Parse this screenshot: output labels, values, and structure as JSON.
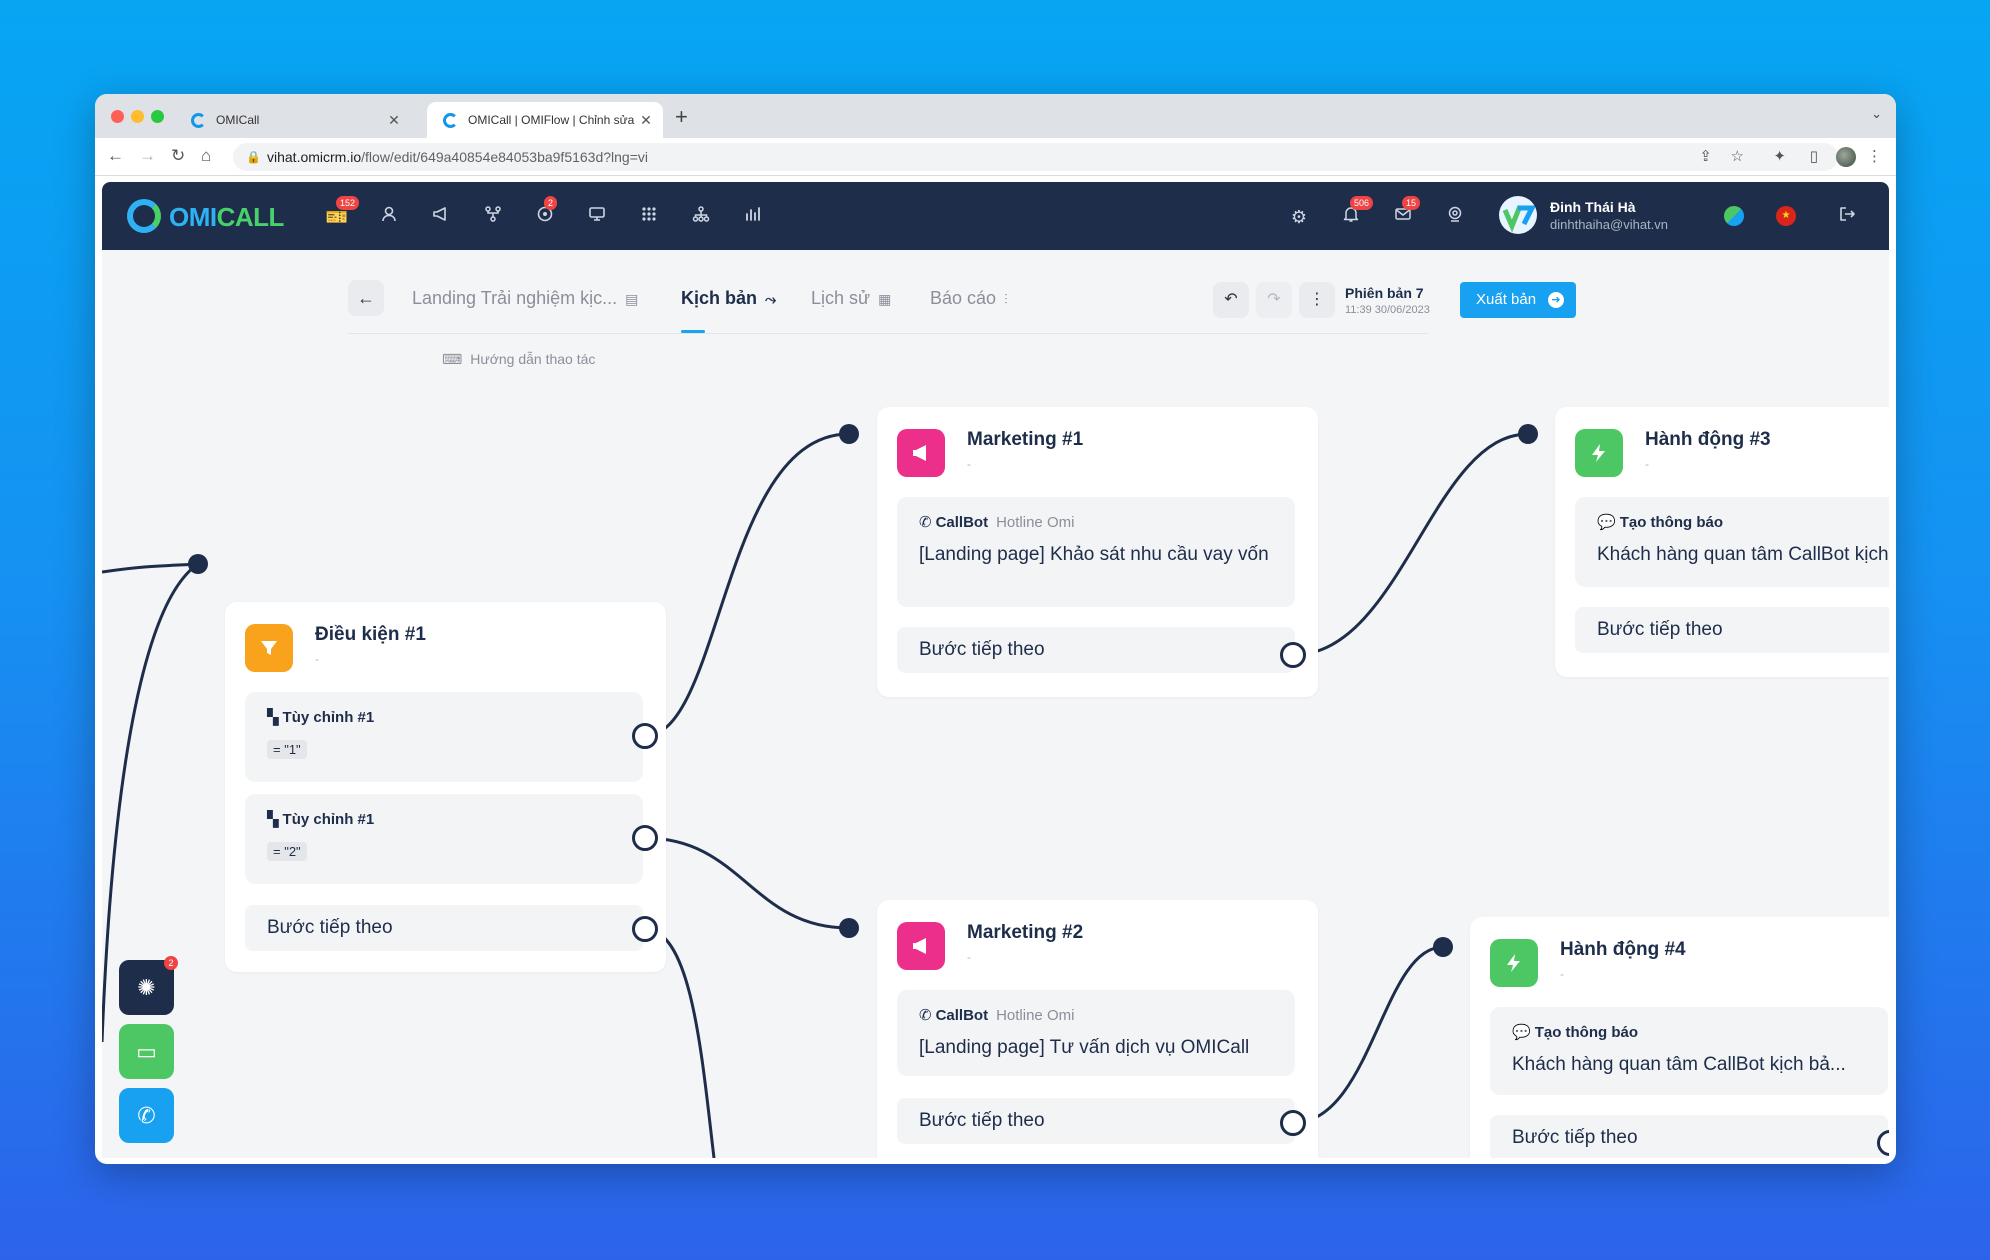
{
  "browser": {
    "tabs": [
      {
        "title": "OMICall"
      },
      {
        "title": "OMICall | OMIFlow | Chỉnh sửa"
      }
    ],
    "url_host": "vihat.omicrm.io",
    "url_path": "/flow/edit/649a40854e84053ba9f5163d?lng=vi"
  },
  "header": {
    "logo_omi": "OMI",
    "logo_call": "CALL",
    "badges": {
      "tickets": "152",
      "integrations": "2",
      "notifications": "506",
      "mail": "15"
    },
    "user_name": "Đinh Thái Hà",
    "user_email": "dinhthaiha@vihat.vn"
  },
  "flow_toolbar": {
    "name_tab": "Landing Trải nghiệm kịc...",
    "tab_script": "Kịch bản",
    "tab_history": "Lịch sử",
    "tab_report": "Báo cáo",
    "version_title": "Phiên bản 7",
    "version_date": "11:39 30/06/2023",
    "publish_label": "Xuất bản",
    "guide_label": "Hướng dẫn thao tác"
  },
  "nodes": {
    "condition1": {
      "title": "Điều kiện #1",
      "subtitle": "-",
      "rules": [
        {
          "label": "Tùy chỉnh #1",
          "value": "= \"1\""
        },
        {
          "label": "Tùy chỉnh #1",
          "value": "= \"2\""
        }
      ],
      "next_step": "Bước tiếp theo"
    },
    "marketing1": {
      "title": "Marketing #1",
      "subtitle": "-",
      "channel": "CallBot",
      "hotline": "Hotline Omi",
      "content": "[Landing page] Khảo sát nhu cầu vay vốn",
      "next_step": "Bước tiếp theo"
    },
    "marketing2": {
      "title": "Marketing #2",
      "subtitle": "-",
      "channel": "CallBot",
      "hotline": "Hotline Omi",
      "content": "[Landing page] Tư vấn dịch vụ OMICall",
      "next_step": "Bước tiếp theo"
    },
    "action3": {
      "title": "Hành động #3",
      "subtitle": "-",
      "action_type": "Tạo thông báo",
      "content": "Khách hàng quan tâm CallBot kịch",
      "next_step": "Bước tiếp theo"
    },
    "action4": {
      "title": "Hành động #4",
      "subtitle": "-",
      "action_type": "Tạo thông báo",
      "content": "Khách hàng quan tâm CallBot kịch bả...",
      "next_step": "Bước tiếp theo"
    }
  },
  "fabs": {
    "badge": "2"
  },
  "colors": {
    "header_bg": "#1e2d4a",
    "accent": "#17a1f0",
    "marketing": "#ec2f8a",
    "condition": "#f9a21b",
    "action": "#4cc764",
    "edge": "#1e2d4a"
  },
  "icons": [
    "ticket-icon",
    "user-icon",
    "megaphone-icon",
    "flow-icon",
    "integration-icon",
    "monitor-icon",
    "apps-icon",
    "org-chart-icon",
    "report-icon",
    "gear-icon",
    "bell-icon",
    "mail-icon",
    "webcam-icon",
    "logout-icon",
    "callbot-icon",
    "notification-icon",
    "support-icon",
    "ticket-add-icon",
    "phone-icon"
  ]
}
